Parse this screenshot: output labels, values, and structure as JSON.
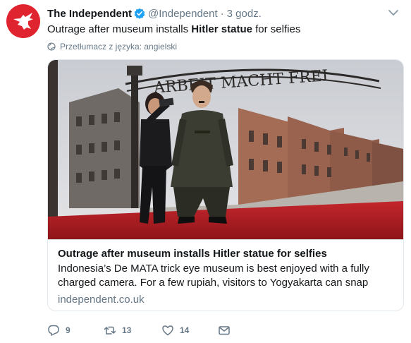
{
  "author": {
    "name": "The Independent",
    "handle": "@Independent",
    "separator": "·",
    "time": "3 godz.",
    "avatar_icon": "independent-eagle-logo",
    "verified_icon": "verified-badge-icon",
    "brand_color": "#e0242f",
    "verified_color": "#1da1f2"
  },
  "tweet": {
    "text_prefix": "Outrage after museum installs ",
    "text_bold": "Hitler statue",
    "text_suffix": " for selfies",
    "translate_label": "Przetłumacz z języka: angielski",
    "translate_icon": "globe-icon"
  },
  "card": {
    "image_description_icon": "article-photo",
    "image_sign_text": "ARBEIT MACHT FREI",
    "title": "Outrage after museum installs Hitler statue for selfies",
    "description": "Indonesia’s De MATA trick eye museum is best enjoyed with a fully charged camera. For a few rupiah, visitors to Yogyakarta can snap photos of th...",
    "domain": "independent.co.uk"
  },
  "actions": {
    "reply_count": "9",
    "retweet_count": "13",
    "like_count": "14",
    "reply_icon": "reply-icon",
    "retweet_icon": "retweet-icon",
    "like_icon": "heart-icon",
    "dm_icon": "envelope-icon"
  },
  "colors": {
    "text": "#14171a",
    "secondary": "#657786",
    "border": "#e1e8ed"
  }
}
